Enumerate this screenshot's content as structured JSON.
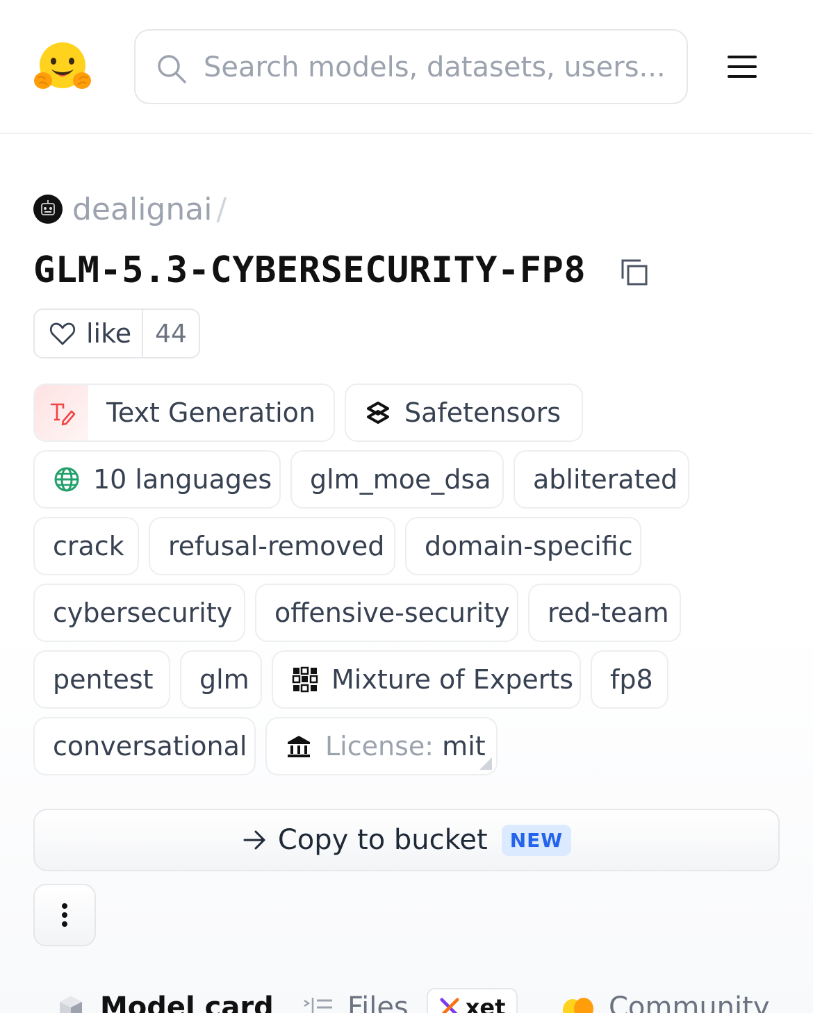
{
  "header": {
    "search_placeholder": "Search models, datasets, users..."
  },
  "repo": {
    "owner": "dealignai",
    "separator": "/",
    "name": "GLM-5.3-CYBERSECURITY-FP8"
  },
  "likes": {
    "label": "like",
    "count": "44"
  },
  "tags": {
    "pipeline": "Text Generation",
    "library": "Safetensors",
    "languages": "10 languages",
    "arch": "glm_moe_dsa",
    "abliterated": "abliterated",
    "crack": "crack",
    "refusal": "refusal-removed",
    "domain": "domain-specific",
    "cyber": "cybersecurity",
    "offensive": "offensive-security",
    "redteam": "red-team",
    "pentest": "pentest",
    "glm": "glm",
    "moe": "Mixture of Experts",
    "fp8": "fp8",
    "conversational": "conversational",
    "license_label": "License:",
    "license_value": "mit"
  },
  "actions": {
    "copy_to_bucket": "Copy to bucket",
    "new_badge": "NEW"
  },
  "tabs": {
    "model_card": "Model card",
    "files": "Files",
    "xet": "xet",
    "community": "Community"
  }
}
